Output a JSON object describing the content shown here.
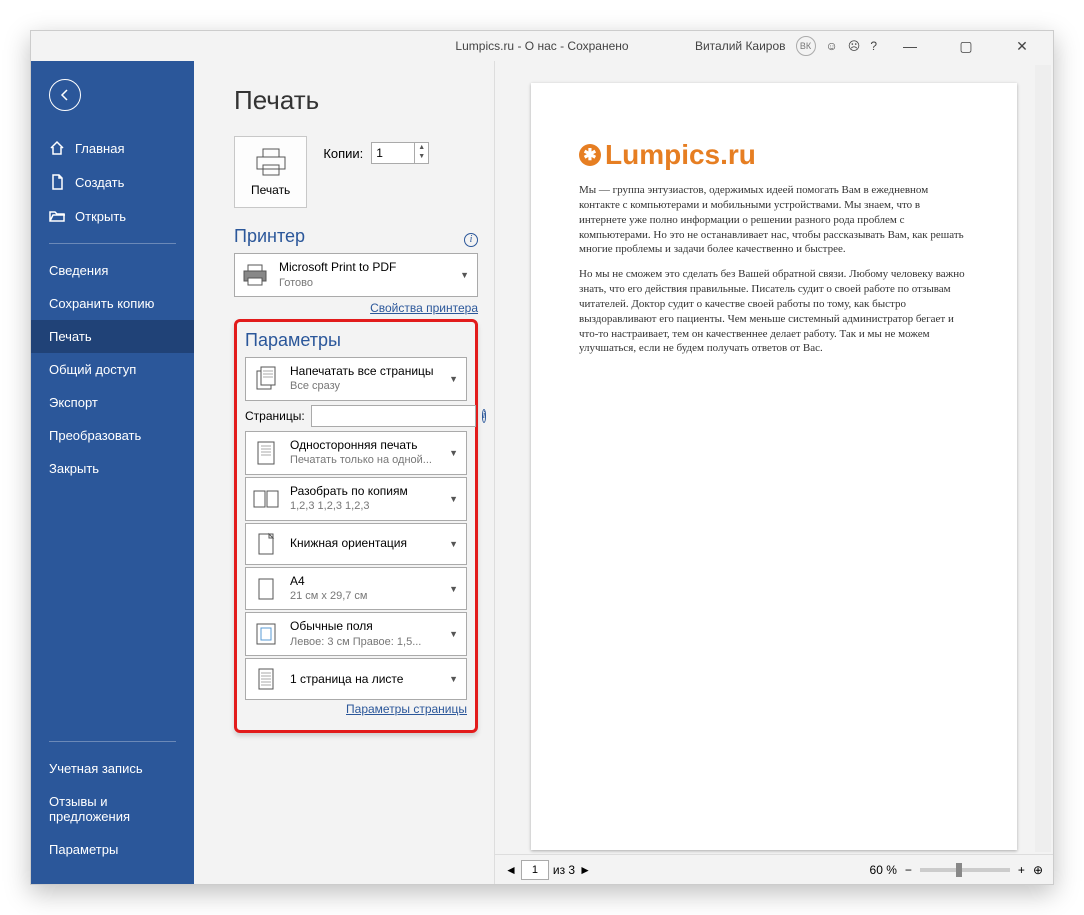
{
  "titlebar": {
    "doc": "Lumpics.ru - О нас - Сохранено",
    "user": "Виталий Каиров",
    "initials": "ВК"
  },
  "sidebar": {
    "home": "Главная",
    "create": "Создать",
    "open": "Открыть",
    "info": "Сведения",
    "save_copy": "Сохранить копию",
    "print": "Печать",
    "share": "Общий доступ",
    "export": "Экспорт",
    "transform": "Преобразовать",
    "close": "Закрыть",
    "account": "Учетная запись",
    "feedback": "Отзывы и предложения",
    "options": "Параметры"
  },
  "page": {
    "title": "Печать"
  },
  "print_btn": {
    "label": "Печать"
  },
  "copies": {
    "label": "Копии:",
    "value": "1"
  },
  "printer": {
    "section": "Принтер",
    "name": "Microsoft Print to PDF",
    "status": "Готово",
    "props_link": "Свойства принтера"
  },
  "settings": {
    "section": "Параметры",
    "all_pages": {
      "main": "Напечатать все страницы",
      "sub": "Все сразу"
    },
    "pages_label": "Страницы:",
    "pages_value": "",
    "sides": {
      "main": "Односторонняя печать",
      "sub": "Печатать только на одной..."
    },
    "collate": {
      "main": "Разобрать по копиям",
      "sub": "1,2,3   1,2,3   1,2,3"
    },
    "orientation": {
      "main": "Книжная ориентация"
    },
    "size": {
      "main": "A4",
      "sub": "21 см x 29,7 см"
    },
    "margins": {
      "main": "Обычные поля",
      "sub": "Левое:  3 см   Правое:  1,5..."
    },
    "sheets": {
      "main": "1 страница на листе"
    },
    "page_setup_link": "Параметры страницы"
  },
  "preview": {
    "logo_text": "Lumpics.ru",
    "para1": "Мы — группа энтузиастов, одержимых идеей помогать Вам в ежедневном контакте с компьютерами и мобильными устройствами. Мы знаем, что в интернете уже полно информации о решении разного рода проблем с компьютерами. Но это не останавливает нас, чтобы рассказывать Вам, как решать многие проблемы и задачи более качественно и быстрее.",
    "para2": "Но мы не сможем это сделать без Вашей обратной связи. Любому человеку важно знать, что его действия правильные. Писатель судит о своей работе по отзывам читателей. Доктор судит о качестве своей работы по тому, как быстро выздоравливают его пациенты. Чем меньше системный администратор бегает и что-то настраивает, тем он качественнее делает работу. Так и мы не можем улучшаться, если не будем получать ответов от Вас."
  },
  "footer": {
    "page": "1",
    "of": "из 3",
    "zoom": "60 %"
  }
}
